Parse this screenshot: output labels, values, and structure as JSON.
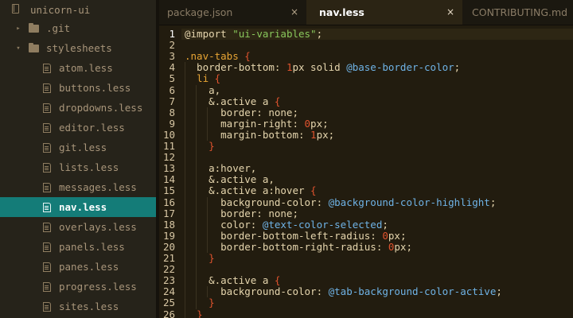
{
  "sidebar": {
    "root": "unicorn-ui",
    "items": [
      {
        "label": ".git",
        "kind": "folder",
        "expanded": false,
        "depth": 1
      },
      {
        "label": "stylesheets",
        "kind": "folder",
        "expanded": true,
        "depth": 1
      },
      {
        "label": "atom.less",
        "kind": "file",
        "depth": 2
      },
      {
        "label": "buttons.less",
        "kind": "file",
        "depth": 2
      },
      {
        "label": "dropdowns.less",
        "kind": "file",
        "depth": 2
      },
      {
        "label": "editor.less",
        "kind": "file",
        "depth": 2
      },
      {
        "label": "git.less",
        "kind": "file",
        "depth": 2
      },
      {
        "label": "lists.less",
        "kind": "file",
        "depth": 2
      },
      {
        "label": "messages.less",
        "kind": "file",
        "depth": 2
      },
      {
        "label": "nav.less",
        "kind": "file",
        "depth": 2,
        "selected": true
      },
      {
        "label": "overlays.less",
        "kind": "file",
        "depth": 2
      },
      {
        "label": "panels.less",
        "kind": "file",
        "depth": 2
      },
      {
        "label": "panes.less",
        "kind": "file",
        "depth": 2
      },
      {
        "label": "progress.less",
        "kind": "file",
        "depth": 2
      },
      {
        "label": "sites.less",
        "kind": "file",
        "depth": 2
      }
    ],
    "selected_color": "#147c78"
  },
  "tabs": [
    {
      "label": "package.json",
      "active": false,
      "close": "×"
    },
    {
      "label": "nav.less",
      "active": true,
      "close": "×"
    },
    {
      "label": "CONTRIBUTING.md",
      "active": false,
      "close": ""
    }
  ],
  "editor": {
    "line_numbers": [
      "1",
      "2",
      "3",
      "4",
      "5",
      "6",
      "7",
      "8",
      "9",
      "10",
      "11",
      "12",
      "13",
      "14",
      "15",
      "16",
      "17",
      "18",
      "19",
      "20",
      "21",
      "22",
      "23",
      "24",
      "25",
      "26"
    ],
    "lines": [
      [
        [
          "t-at",
          "@import "
        ],
        [
          "t-str",
          "\"ui-variables\""
        ],
        [
          "t-plain",
          ";"
        ]
      ],
      [],
      [
        [
          "t-sel",
          ".nav-tabs"
        ],
        [
          "t-plain",
          " "
        ],
        [
          "t-brace",
          "{"
        ]
      ],
      [
        [
          "t-plain",
          "  border-bottom: "
        ],
        [
          "t-num",
          "1"
        ],
        [
          "t-plain",
          "px solid "
        ],
        [
          "t-var",
          "@base-border-color"
        ],
        [
          "t-plain",
          ";"
        ]
      ],
      [
        [
          "t-plain",
          "  "
        ],
        [
          "t-sel",
          "li"
        ],
        [
          "t-plain",
          " "
        ],
        [
          "t-brace",
          "{"
        ]
      ],
      [
        [
          "t-plain",
          "    a,"
        ]
      ],
      [
        [
          "t-plain",
          "    &.active a "
        ],
        [
          "t-brace",
          "{"
        ]
      ],
      [
        [
          "t-plain",
          "      border: none;"
        ]
      ],
      [
        [
          "t-plain",
          "      margin-right: "
        ],
        [
          "t-num",
          "0"
        ],
        [
          "t-plain",
          "px;"
        ]
      ],
      [
        [
          "t-plain",
          "      margin-bottom: "
        ],
        [
          "t-num",
          "1"
        ],
        [
          "t-plain",
          "px;"
        ]
      ],
      [
        [
          "t-plain",
          "    "
        ],
        [
          "t-brace",
          "}"
        ]
      ],
      [],
      [
        [
          "t-plain",
          "    a:hover,"
        ]
      ],
      [
        [
          "t-plain",
          "    &.active a,"
        ]
      ],
      [
        [
          "t-plain",
          "    &.active a:hover "
        ],
        [
          "t-brace",
          "{"
        ]
      ],
      [
        [
          "t-plain",
          "      background-color: "
        ],
        [
          "t-var",
          "@background-color-highlight"
        ],
        [
          "t-plain",
          ";"
        ]
      ],
      [
        [
          "t-plain",
          "      border: none;"
        ]
      ],
      [
        [
          "t-plain",
          "      color: "
        ],
        [
          "t-var",
          "@text-color-selected"
        ],
        [
          "t-plain",
          ";"
        ]
      ],
      [
        [
          "t-plain",
          "      border-bottom-left-radius: "
        ],
        [
          "t-num",
          "0"
        ],
        [
          "t-plain",
          "px;"
        ]
      ],
      [
        [
          "t-plain",
          "      border-bottom-right-radius: "
        ],
        [
          "t-num",
          "0"
        ],
        [
          "t-plain",
          "px;"
        ]
      ],
      [
        [
          "t-plain",
          "    "
        ],
        [
          "t-brace",
          "}"
        ]
      ],
      [],
      [
        [
          "t-plain",
          "    &.active a "
        ],
        [
          "t-brace",
          "{"
        ]
      ],
      [
        [
          "t-plain",
          "      background-color: "
        ],
        [
          "t-var",
          "@tab-background-color-active"
        ],
        [
          "t-plain",
          ";"
        ]
      ],
      [
        [
          "t-plain",
          "    "
        ],
        [
          "t-brace",
          "}"
        ]
      ],
      [
        [
          "t-plain",
          "  "
        ],
        [
          "t-brace",
          "}"
        ]
      ]
    ]
  }
}
